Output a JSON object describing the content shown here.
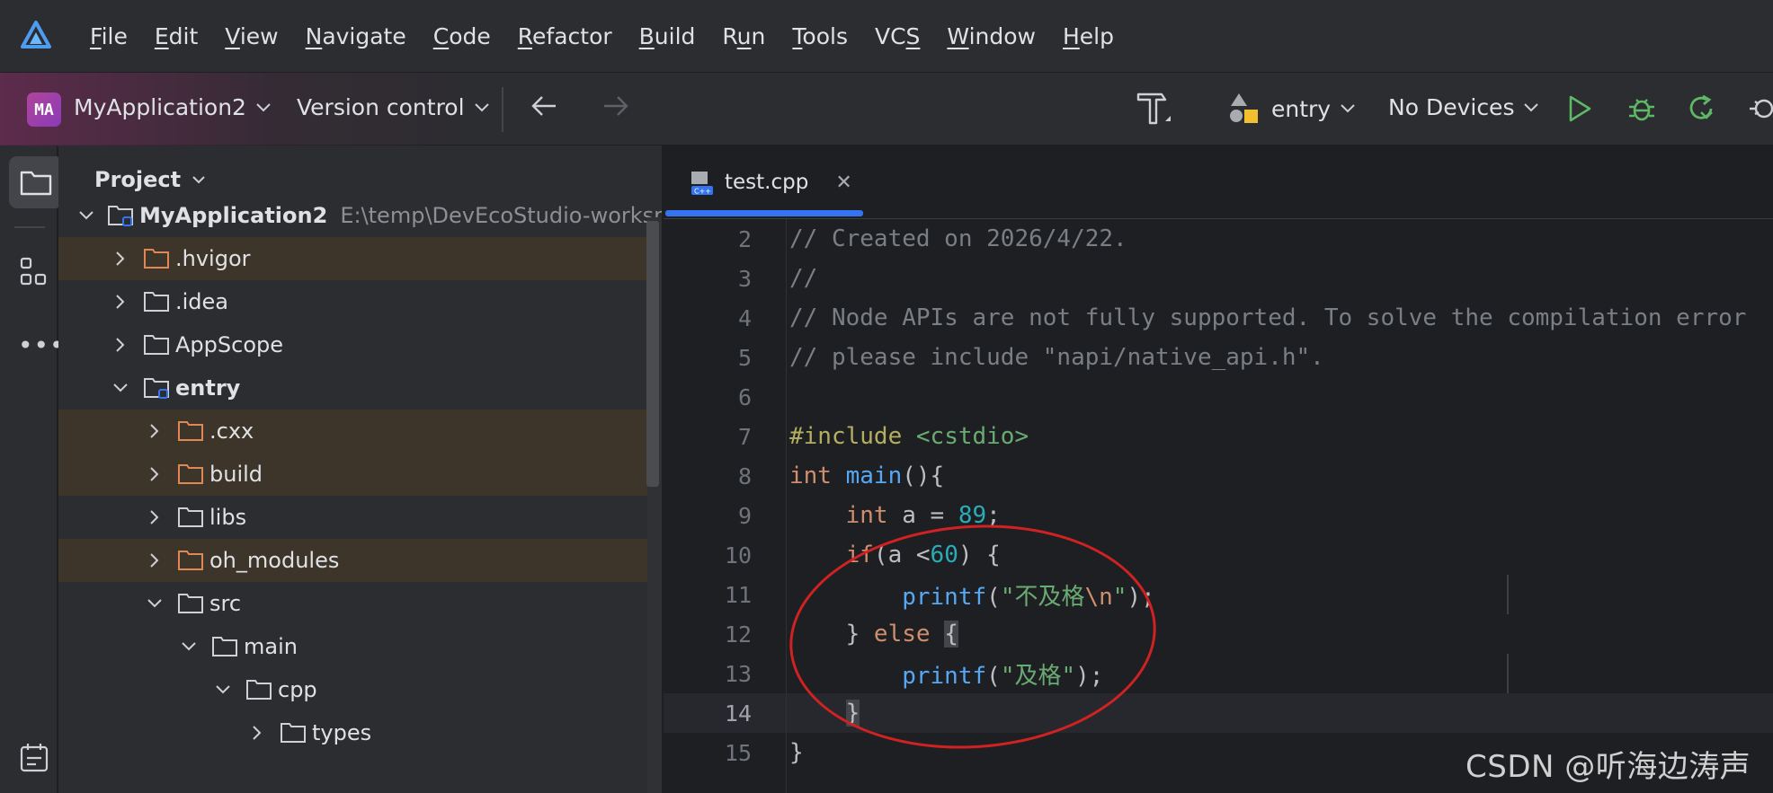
{
  "menubar": {
    "items": [
      {
        "mnemonic": "F",
        "rest": "ile"
      },
      {
        "mnemonic": "E",
        "rest": "dit"
      },
      {
        "mnemonic": "V",
        "rest": "iew"
      },
      {
        "mnemonic": "N",
        "rest": "avigate"
      },
      {
        "mnemonic": "C",
        "rest": "ode"
      },
      {
        "mnemonic": "R",
        "rest": "efactor"
      },
      {
        "mnemonic": "B",
        "rest": "uild"
      },
      {
        "pre": "R",
        "mnemonic": "u",
        "rest": "n"
      },
      {
        "mnemonic": "T",
        "rest": "ools"
      },
      {
        "pre": "VC",
        "mnemonic": "S",
        "rest": ""
      },
      {
        "mnemonic": "W",
        "rest": "indow"
      },
      {
        "mnemonic": "H",
        "rest": "elp"
      }
    ]
  },
  "toolbar": {
    "project_badge": "MA",
    "project_name": "MyApplication2",
    "version_control": "Version control",
    "module": "entry",
    "devices": "No Devices"
  },
  "project_panel": {
    "title": "Project",
    "tree": [
      {
        "label": "MyApplication2",
        "path": "E:\\temp\\DevEcoStudio-worksp"
      },
      {
        "label": ".hvigor"
      },
      {
        "label": ".idea"
      },
      {
        "label": "AppScope"
      },
      {
        "label": "entry"
      },
      {
        "label": ".cxx"
      },
      {
        "label": "build"
      },
      {
        "label": "libs"
      },
      {
        "label": "oh_modules"
      },
      {
        "label": "src"
      },
      {
        "label": "main"
      },
      {
        "label": "cpp"
      },
      {
        "label": "types"
      }
    ]
  },
  "editor": {
    "tab_label": "test.cpp",
    "line_numbers": [
      "2",
      "3",
      "4",
      "5",
      "6",
      "7",
      "8",
      "9",
      "10",
      "11",
      "12",
      "13",
      "14",
      "15"
    ],
    "code": {
      "l2": "// Created on 2026/4/22.",
      "l3": "//",
      "l4": "// Node APIs are not fully supported. To solve the compilation error",
      "l5": "// please include \"napi/native_api.h\".",
      "l7a": "#include",
      "l7b": " <cstdio>",
      "l8a": "int",
      "l8b": " ",
      "l8c": "main",
      "l8d": "(){",
      "l9a": "    int",
      "l9b": " a = ",
      "l9c": "89",
      "l9d": ";",
      "l10a": "    if",
      "l10b": "(a <",
      "l10c": "60",
      "l10d": ") {",
      "l11a": "        printf",
      "l11b": "(",
      "l11c": "\"不及格",
      "l11d": "\\n",
      "l11e": "\"",
      "l11f": ");",
      "l12a": "    } ",
      "l12b": "else",
      "l12c": " ",
      "l12d": "{",
      "l13a": "        printf",
      "l13b": "(",
      "l13c": "\"及格\"",
      "l13d": ");",
      "l14a": "    ",
      "l14b": "}",
      "l15": "}"
    }
  },
  "watermark": "CSDN @听海边涛声",
  "colors": {
    "accent": "#3574f0",
    "annotation": "#d02222",
    "run": "#5fb865"
  }
}
